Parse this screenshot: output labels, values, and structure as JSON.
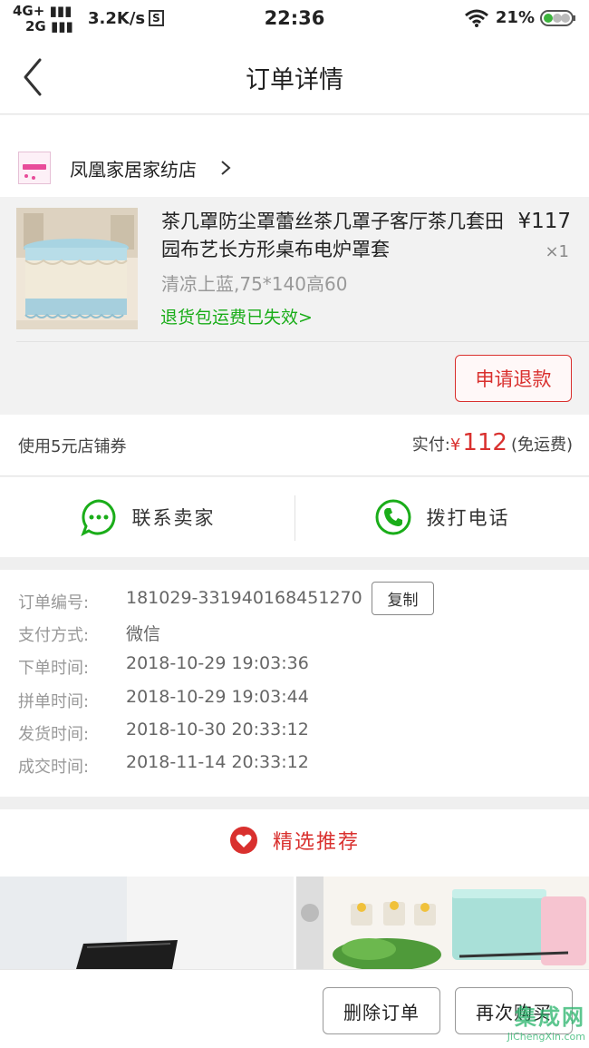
{
  "status_bar": {
    "network_1": "4G+",
    "network_2": "2G",
    "speed": "3.2K/s",
    "s_badge": "S",
    "time": "22:36",
    "battery": "21%"
  },
  "header": {
    "title": "订单详情"
  },
  "shop": {
    "name": "凤凰家居家纺店"
  },
  "product": {
    "name": "茶几罩防尘罩蕾丝茶几罩子客厅茶几套田园布艺长方形桌布电炉罩套",
    "spec": "清凉上蓝,75*140高60",
    "return_note": "退货包运费已失效>",
    "price": "¥117",
    "quantity": "×1",
    "refund_label": "申请退款"
  },
  "payment": {
    "coupon": "使用5元店铺券",
    "paid_label": "实付:",
    "currency": "¥",
    "amount": "112",
    "shipping_note": "(免运费)"
  },
  "contact": {
    "seller_label": "联系卖家",
    "phone_label": "拨打电话"
  },
  "order_info": {
    "copy_label": "复制",
    "rows": [
      {
        "label": "订单编号:",
        "value": "181029-331940168451270"
      },
      {
        "label": "支付方式:",
        "value": "微信"
      },
      {
        "label": "下单时间:",
        "value": "2018-10-29 19:03:36"
      },
      {
        "label": "拼单时间:",
        "value": "2018-10-29 19:03:44"
      },
      {
        "label": "发货时间:",
        "value": "2018-10-30 20:33:12"
      },
      {
        "label": "成交时间:",
        "value": "2018-11-14 20:33:12"
      }
    ]
  },
  "recommend": {
    "title": "精选推荐"
  },
  "bottom_bar": {
    "delete_label": "删除订单",
    "rebuy_label": "再次购买"
  },
  "watermark": {
    "text": "集成网",
    "url": "JiChengXin.com"
  },
  "colors": {
    "accent_red": "#d9302e",
    "green": "#1aad19",
    "wechat_green": "#27b36a"
  }
}
